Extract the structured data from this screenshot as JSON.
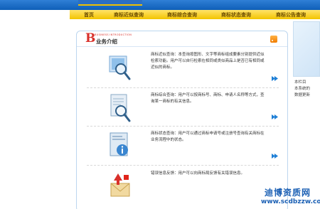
{
  "nav": {
    "items": [
      {
        "label": "首页"
      },
      {
        "label": "商标近似查询"
      },
      {
        "label": "商标综合查询"
      },
      {
        "label": "商标状态查询"
      },
      {
        "label": "商标公告查询"
      }
    ]
  },
  "panel": {
    "letter": "B",
    "english": "BUSINESS INTRODUCTION",
    "title": "业务介绍",
    "rows": [
      {
        "icon": "magnifier-picture-icon",
        "text": "商标近似查询：本查询按图形、文字等商标组成要素分别提供近似检索功能。用户可以自行检索在相同或类似商品上是否已有相同或近似的商标。"
      },
      {
        "icon": "magnifier-document-icon",
        "text": "商标综合查询：用户可以按商标号、商标、申请人名称等方式，查询某一商标的有关信息。"
      },
      {
        "icon": "info-document-icon",
        "text": "商标状态查询：用户可以通过商标申请号或注册号查询有关商标在业务流程中的状态。"
      },
      {
        "icon": "mail-notice-icon",
        "text": "错误信息反馈：用户可以向商标局反馈有关错误信息。"
      }
    ]
  },
  "right": {
    "lines": [
      "本栏目",
      "本系统的",
      "数据更新"
    ]
  },
  "watermark": {
    "name": "迪博资质网",
    "url": "www.scdbzzw.com"
  },
  "colors": {
    "nav_bg": "#f3c400",
    "accent_red": "#d9302a",
    "arrow_blue": "#1e7fd6",
    "border_blue": "#bcd6ef"
  }
}
